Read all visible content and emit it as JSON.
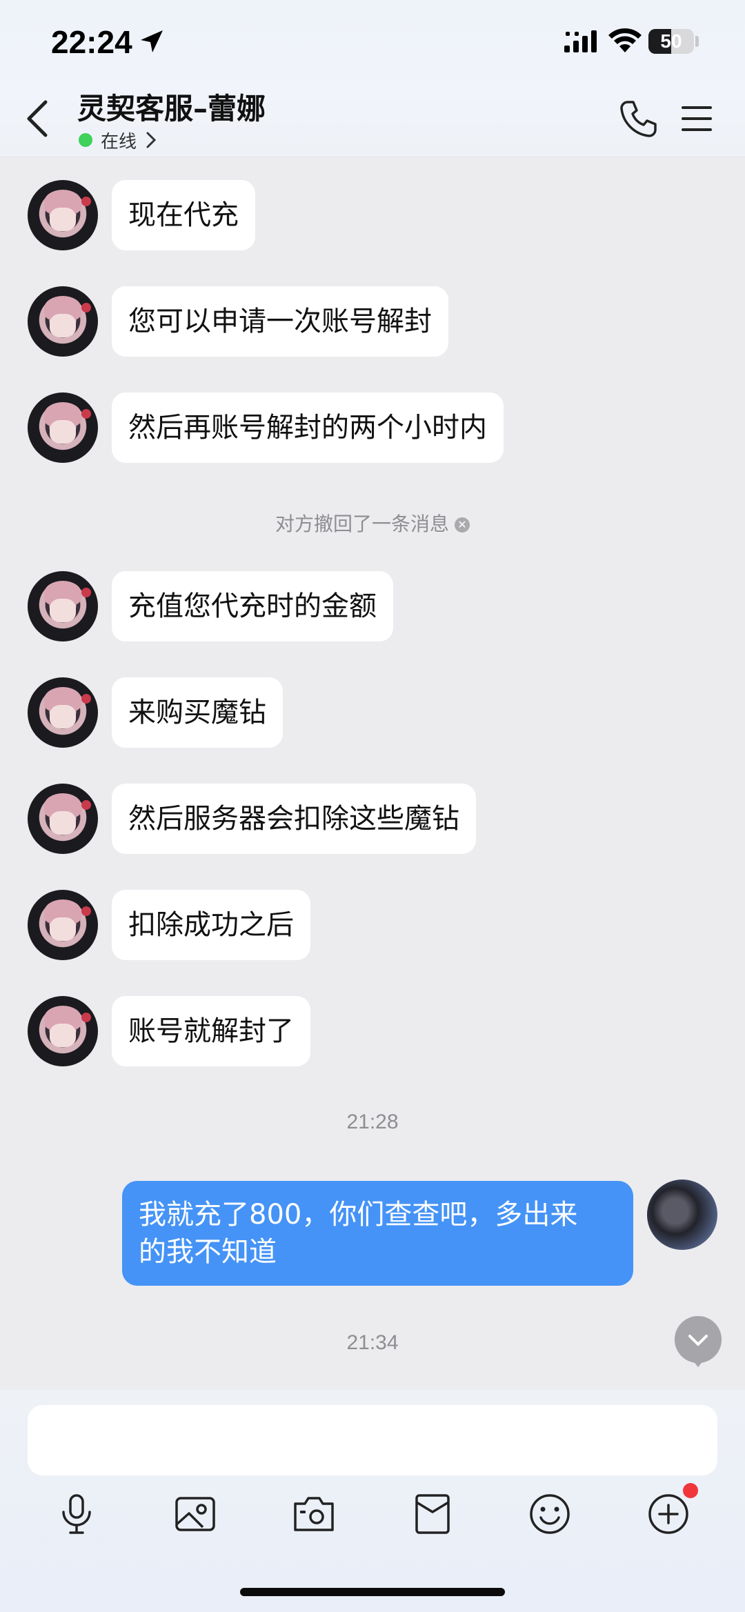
{
  "status_bar": {
    "time": "22:24",
    "battery_level": "50",
    "battery_fraction": 0.5
  },
  "header": {
    "title": "灵契客服–蕾娜",
    "status_text": "在线",
    "status_color": "#3fd15a"
  },
  "messages": [
    {
      "text": "现在代充"
    },
    {
      "text": "您可以申请一次账号解封"
    },
    {
      "text": "然后再账号解封的两个小时内"
    },
    {
      "text": "充值您代充时的金额"
    },
    {
      "text": "来购买魔钻"
    },
    {
      "text": "然后服务器会扣除这些魔钻"
    },
    {
      "text": "扣除成功之后"
    },
    {
      "text": "账号就解封了"
    }
  ],
  "system_note": "对方撤回了一条消息",
  "timestamps": [
    "21:28",
    "21:34"
  ],
  "self_message": {
    "line1": "我就充了800，你们查查吧，多出来",
    "line2": "的我不知道"
  },
  "colors": {
    "self_bubble": "#4593f6",
    "unread_dot": "#f0363b"
  },
  "toolbar": {
    "icons": [
      "microphone-icon",
      "image-icon",
      "camera-icon",
      "red-packet-icon",
      "emoji-icon",
      "plus-icon"
    ]
  }
}
